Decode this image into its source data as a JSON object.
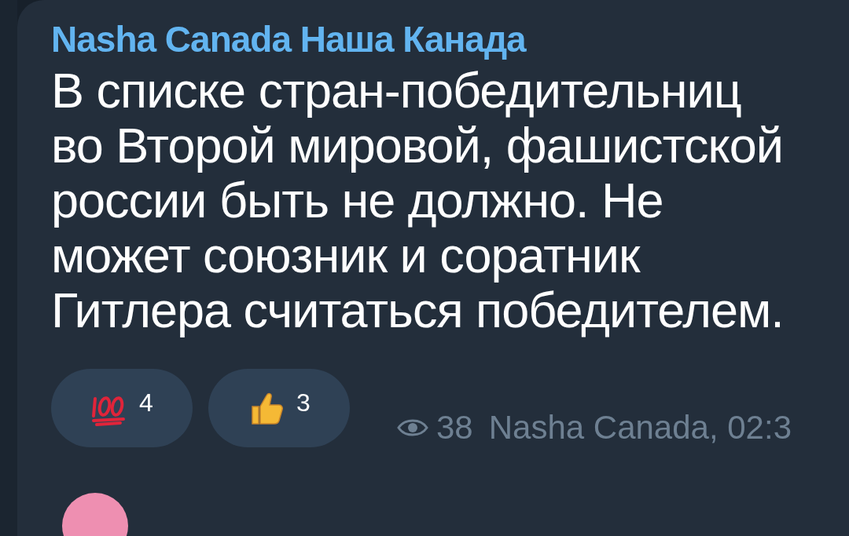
{
  "message": {
    "channel": "Nasha Canada Наша Канада",
    "text": "В списке стран-победительниц\nво Второй мировой, фашистской\nроссии быть не должно. Не\nможет союзник и соратник\nГитлера считаться победителем.",
    "reactions": [
      {
        "kind": "hundred",
        "count": "4"
      },
      {
        "kind": "thumbs",
        "count": "3"
      }
    ],
    "views": "38",
    "footer": "Nasha Canada, 02:3"
  }
}
